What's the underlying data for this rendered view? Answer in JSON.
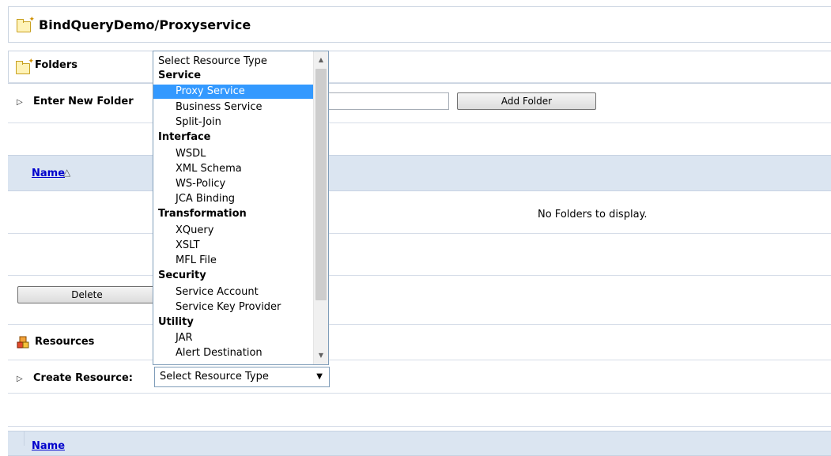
{
  "header": {
    "title": "BindQueryDemo/Proxyservice"
  },
  "folders": {
    "title": "Folders",
    "enter_label": "Enter New Folder",
    "new_folder_value": "",
    "add_button": "Add Folder",
    "column_name": "Name",
    "empty_message": "No Folders to display.",
    "delete_button": "Delete"
  },
  "resources": {
    "title": "Resources",
    "create_label": "Create Resource:",
    "select_value": "Select Resource Type",
    "column_name": "Name"
  },
  "dropdown": {
    "title": "Select Resource Type",
    "selected": "Proxy Service",
    "groups": [
      {
        "label": "Service",
        "items": [
          "Proxy Service",
          "Business Service",
          "Split-Join"
        ]
      },
      {
        "label": "Interface",
        "items": [
          "WSDL",
          "XML Schema",
          "WS-Policy",
          "JCA Binding"
        ]
      },
      {
        "label": "Transformation",
        "items": [
          "XQuery",
          "XSLT",
          "MFL File"
        ]
      },
      {
        "label": "Security",
        "items": [
          "Service Account",
          "Service Key Provider"
        ]
      },
      {
        "label": "Utility",
        "items": [
          "JAR",
          "Alert Destination"
        ]
      }
    ]
  },
  "icons": {
    "folder": "folder-icon",
    "resources": "resources-icon",
    "expand": "expand-triangle-icon",
    "sort": "sort-ascending-icon"
  },
  "colors": {
    "grid_header": "#dbe5f1",
    "selection": "#3399ff",
    "link": "#0000cc"
  }
}
